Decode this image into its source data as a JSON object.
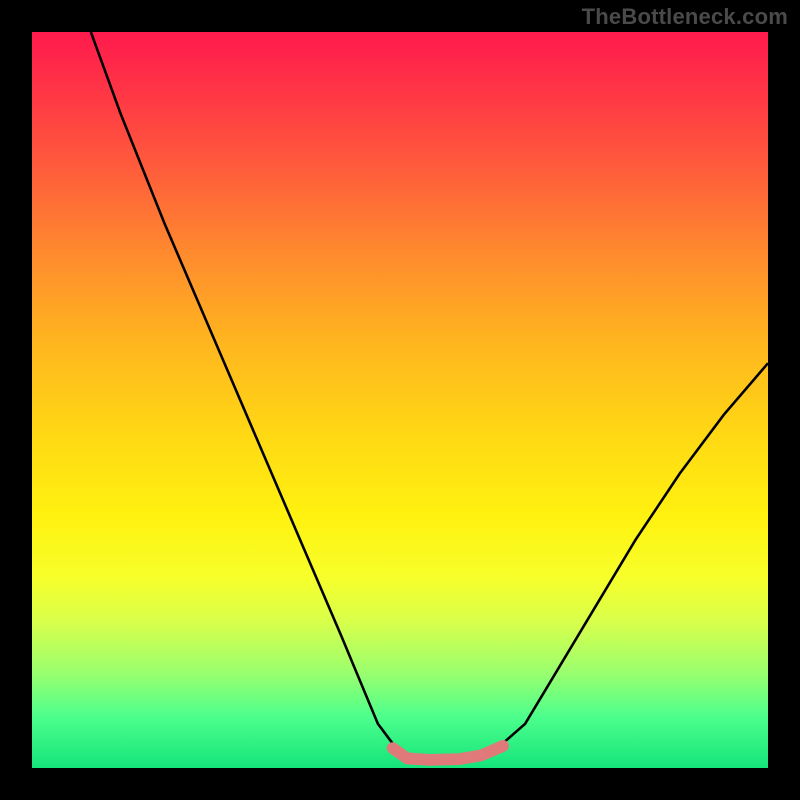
{
  "attribution": "TheBottleneck.com",
  "chart_data": {
    "type": "line",
    "title": "",
    "xlabel": "",
    "ylabel": "",
    "xlim": [
      0,
      100
    ],
    "ylim": [
      0,
      100
    ],
    "background_gradient_stops": [
      {
        "pos": 0,
        "color": "#ff1a4d"
      },
      {
        "pos": 18,
        "color": "#ff5a3c"
      },
      {
        "pos": 42,
        "color": "#ffb51f"
      },
      {
        "pos": 66,
        "color": "#fff210"
      },
      {
        "pos": 87,
        "color": "#9bff6e"
      },
      {
        "pos": 100,
        "color": "#14e47a"
      }
    ],
    "series": [
      {
        "name": "black-curve",
        "color": "#000000",
        "stroke_width": 2,
        "x": [
          8,
          12,
          18,
          24,
          30,
          36,
          42,
          47,
          50,
          53,
          56,
          60,
          63,
          67,
          70,
          76,
          82,
          88,
          94,
          100
        ],
        "y": [
          100,
          89,
          74,
          60,
          46,
          32,
          18,
          6,
          2,
          1,
          1,
          1.5,
          2.5,
          6,
          11,
          21,
          31,
          40,
          48,
          55
        ]
      },
      {
        "name": "pink-bottom-band",
        "color": "#e07a7a",
        "stroke_width": 10,
        "x": [
          49,
          51,
          54,
          58,
          61,
          64
        ],
        "y": [
          2.7,
          1.3,
          1.1,
          1.2,
          1.7,
          3.0
        ]
      }
    ]
  }
}
